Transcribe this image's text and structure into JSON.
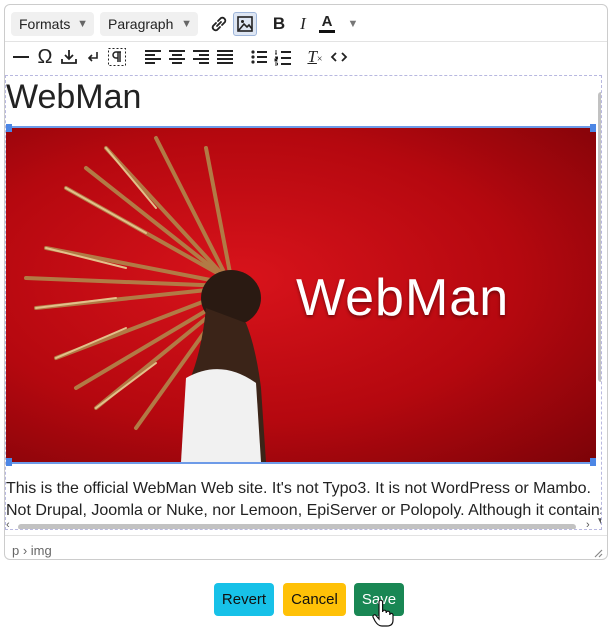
{
  "toolbar": {
    "formats_label": "Formats",
    "block_label": "Paragraph",
    "bold_glyph": "B",
    "italic_glyph": "I",
    "text_color_glyph": "A",
    "clear_format_glyph": "T",
    "chevron": "⌄"
  },
  "content": {
    "heading": "WebMan",
    "image_text": "WebMan",
    "paragraph": "This is the official WebMan Web site. It's not Typo3. It is not WordPress or Mambo. Not Drupal, Joomla or Nuke, nor Lemoon, EpiServer or Polopoly. Although it contains"
  },
  "status": {
    "path": "p › img"
  },
  "actions": {
    "revert": "Revert",
    "cancel": "Cancel",
    "save": "Save"
  },
  "colors": {
    "revert": "#17c1e8",
    "cancel": "#ffc107",
    "save": "#198754",
    "selection": "#4c86e5"
  }
}
